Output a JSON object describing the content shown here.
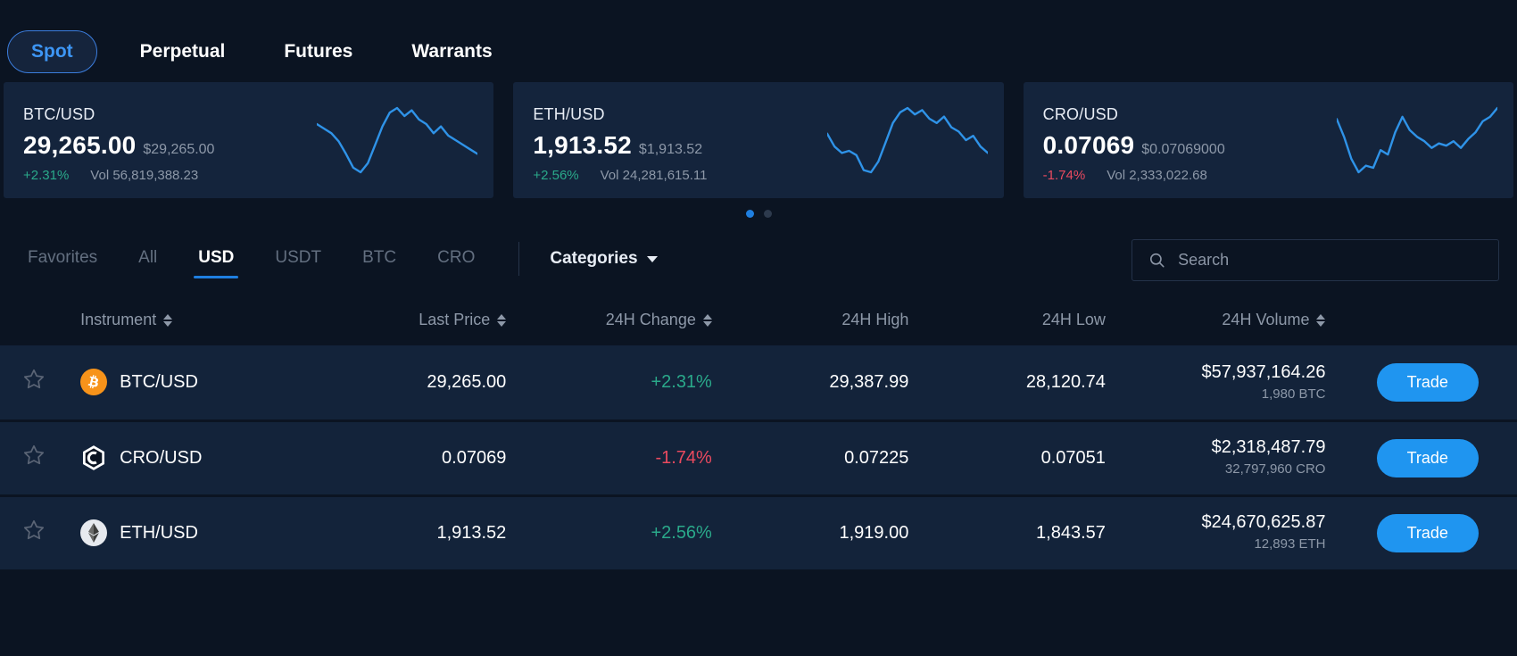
{
  "product_tabs": [
    {
      "label": "Spot",
      "active": true
    },
    {
      "label": "Perpetual",
      "active": false
    },
    {
      "label": "Futures",
      "active": false
    },
    {
      "label": "Warrants",
      "active": false
    }
  ],
  "ticker_cards": [
    {
      "symbol": "BTC/USD",
      "price": "29,265.00",
      "usd_price": "$29,265.00",
      "change": "+2.31%",
      "direction": "up",
      "volume": "Vol 56,819,388.23",
      "spark_color": "#2f93e8",
      "sparkline": [
        48,
        44,
        40,
        33,
        22,
        10,
        6,
        14,
        30,
        46,
        58,
        62,
        55,
        60,
        52,
        48,
        40,
        46,
        38,
        34,
        30,
        26,
        22
      ]
    },
    {
      "symbol": "ETH/USD",
      "price": "1,913.52",
      "usd_price": "$1,913.52",
      "change": "+2.56%",
      "direction": "up",
      "volume": "Vol 24,281,615.11",
      "spark_color": "#2f93e8",
      "sparkline": [
        42,
        30,
        24,
        26,
        22,
        8,
        6,
        16,
        34,
        52,
        62,
        66,
        60,
        64,
        56,
        52,
        58,
        48,
        44,
        36,
        40,
        30,
        24
      ]
    },
    {
      "symbol": "CRO/USD",
      "price": "0.07069",
      "usd_price": "$0.07069000",
      "change": "-1.74%",
      "direction": "down",
      "volume": "Vol 2,333,022.68",
      "spark_color": "#2f93e8",
      "sparkline": [
        56,
        40,
        20,
        8,
        14,
        12,
        28,
        24,
        44,
        58,
        46,
        40,
        36,
        30,
        34,
        32,
        36,
        30,
        38,
        44,
        54,
        58,
        66
      ]
    }
  ],
  "pager": {
    "total": 2,
    "active_index": 0
  },
  "quote_tabs": [
    {
      "label": "Favorites",
      "active": false
    },
    {
      "label": "All",
      "active": false
    },
    {
      "label": "USD",
      "active": true
    },
    {
      "label": "USDT",
      "active": false
    },
    {
      "label": "BTC",
      "active": false
    },
    {
      "label": "CRO",
      "active": false
    }
  ],
  "categories": {
    "label": "Categories"
  },
  "search": {
    "value": "",
    "placeholder": "Search"
  },
  "table": {
    "columns": [
      {
        "label": "Instrument",
        "sortable": true
      },
      {
        "label": "Last Price",
        "sortable": true
      },
      {
        "label": "24H Change",
        "sortable": true
      },
      {
        "label": "24H High",
        "sortable": false
      },
      {
        "label": "24H Low",
        "sortable": false
      },
      {
        "label": "24H Volume",
        "sortable": true
      }
    ],
    "rows": [
      {
        "instrument": "BTC/USD",
        "icon": "bitcoin-icon",
        "icon_color": "#f7931a",
        "last_price": "29,265.00",
        "change": "+2.31%",
        "direction": "up",
        "high": "29,387.99",
        "low": "28,120.74",
        "volume_usd": "$57,937,164.26",
        "volume_base": "1,980 BTC",
        "trade_label": "Trade",
        "favorited": false
      },
      {
        "instrument": "CRO/USD",
        "icon": "cronos-icon",
        "icon_color": "#ffffff",
        "last_price": "0.07069",
        "change": "-1.74%",
        "direction": "down",
        "high": "0.07225",
        "low": "0.07051",
        "volume_usd": "$2,318,487.79",
        "volume_base": "32,797,960 CRO",
        "trade_label": "Trade",
        "favorited": false
      },
      {
        "instrument": "ETH/USD",
        "icon": "ethereum-icon",
        "icon_color": "#d8dce3",
        "last_price": "1,913.52",
        "change": "+2.56%",
        "direction": "up",
        "high": "1,919.00",
        "low": "1,843.57",
        "volume_usd": "$24,670,625.87",
        "volume_base": "12,893 ETH",
        "trade_label": "Trade",
        "favorited": false
      }
    ]
  },
  "colors": {
    "background": "#0b1422",
    "card": "#14243c",
    "row": "#13233a",
    "accent": "#1f95f0",
    "up": "#2aa98a",
    "down": "#ea4a5f",
    "muted": "#8d98a8"
  }
}
